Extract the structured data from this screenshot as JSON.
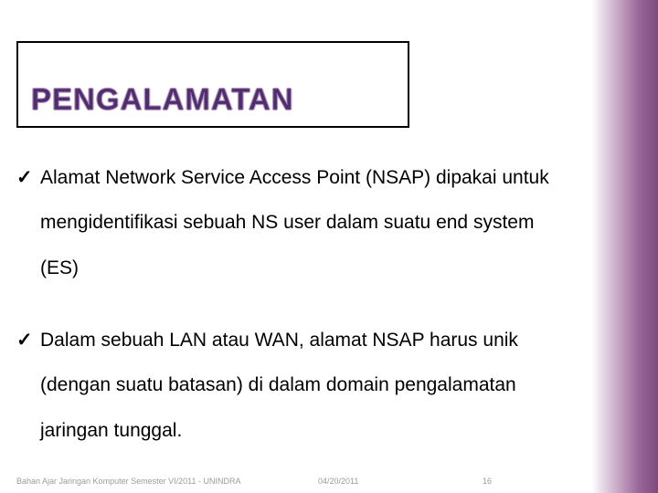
{
  "title": "PENGALAMATAN",
  "bullets": [
    "Alamat Network Service Access Point (NSAP) dipakai untuk mengidentifikasi sebuah NS user dalam suatu end system (ES)",
    "Dalam sebuah LAN atau WAN, alamat NSAP harus unik (dengan suatu batasan) di dalam domain pengalamatan jaringan tunggal."
  ],
  "footer": {
    "left": "Bahan Ajar Jaringan Komputer Semester VI/2011 - UNINDRA",
    "date": "04/20/2011",
    "page": "16"
  }
}
